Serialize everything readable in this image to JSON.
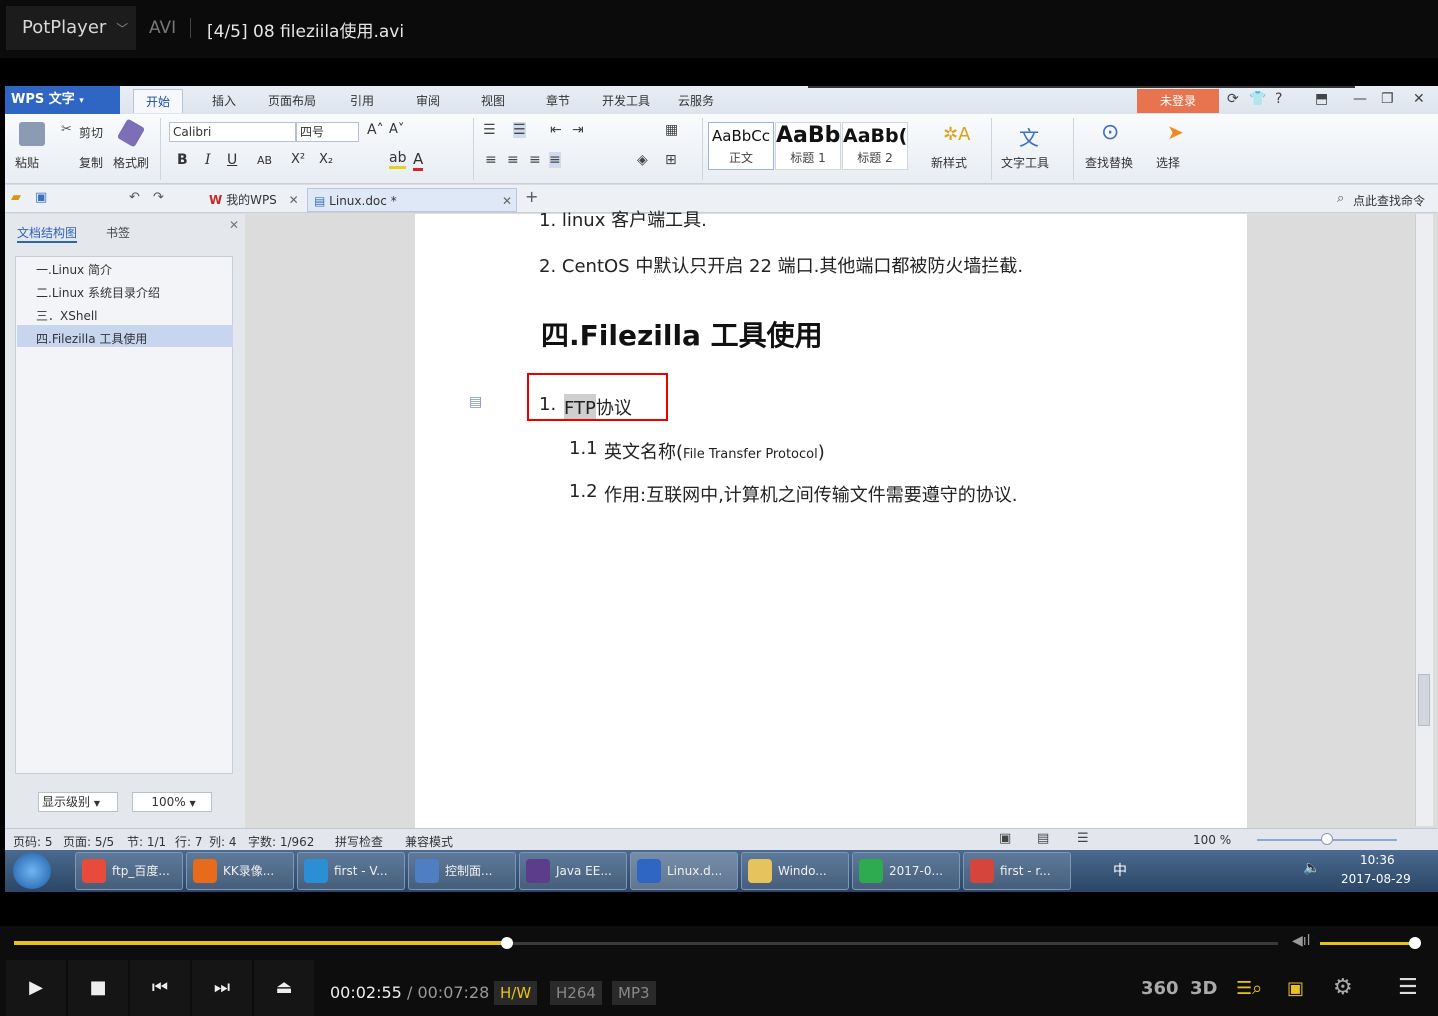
{
  "player": {
    "app_name": "PotPlayer",
    "format": "AVI",
    "title": "[4/5] 08 fileziila使用.avi",
    "time_current": "00:02:55",
    "time_separator": "/",
    "time_total": "00:07:28",
    "badges": [
      "H/W",
      "H264",
      "MP3"
    ],
    "progress_fraction": 0.39,
    "volume_fraction": 1.0,
    "right_icons": [
      "360",
      "3D"
    ]
  },
  "wps": {
    "logo": "WPS 文字",
    "tabs": [
      "开始",
      "插入",
      "页面布局",
      "引用",
      "审阅",
      "视图",
      "章节",
      "开发工具",
      "云服务"
    ],
    "login_label": "未登录",
    "ribbon": {
      "paste": "粘贴",
      "cut": "剪切",
      "copy": "复制",
      "format_painter": "格式刷",
      "font_name": "Calibri",
      "font_size": "四号",
      "styles": [
        {
          "sample": "AaBbCc",
          "name": "正文"
        },
        {
          "sample": "AaBb",
          "name": "标题 1"
        },
        {
          "sample": "AaBb(",
          "name": "标题 2"
        }
      ],
      "new_style": "新样式",
      "text_tools": "文字工具",
      "find_replace": "查找替换",
      "select": "选择"
    },
    "doc_tabs": [
      "我的WPS",
      "Linux.doc *"
    ],
    "find_command": "点此查找命令",
    "nav": {
      "tab_structure": "文档结构图",
      "tab_bookmarks": "书签",
      "items": [
        "一.Linux 简介",
        "二.Linux 系统目录介绍",
        "三．XShell",
        "四.Filezilla 工具使用"
      ],
      "level_label": "显示级别",
      "zoom": "100%"
    },
    "document": {
      "line0": "1.  linux 客户端工具.",
      "line1": "2.  CentOS 中默认只开启 22 端口.其他端口都被防火墙拦截.",
      "heading": "四.Filezilla 工具使用",
      "item1_num": "1.",
      "item1_text": "FTP协议",
      "sub1_num": "1.1",
      "sub1_text": "英文名称(",
      "sub1_en": "File Transfer Protocol",
      "sub1_close": ")",
      "sub2_num": "1.2",
      "sub2_text": "作用:互联网中,计算机之间传输文件需要遵守的协议."
    },
    "status": {
      "page_no": "页码: 5",
      "pages": "页面: 5/5",
      "section": "节: 1/1",
      "row": "行: 7",
      "col": "列: 4",
      "words": "字数: 1/962",
      "spell": "拼写检查",
      "compat": "兼容模式",
      "zoom": "100 %"
    }
  },
  "taskbar": {
    "items": [
      "ftp_百度...",
      "KK录像...",
      "first - V...",
      "控制面...",
      "Java EE...",
      "Linux.d...",
      "Windo...",
      "2017-0...",
      "first - r..."
    ],
    "ime": "中",
    "clock_time": "10:36",
    "clock_date": "2017-08-29"
  }
}
